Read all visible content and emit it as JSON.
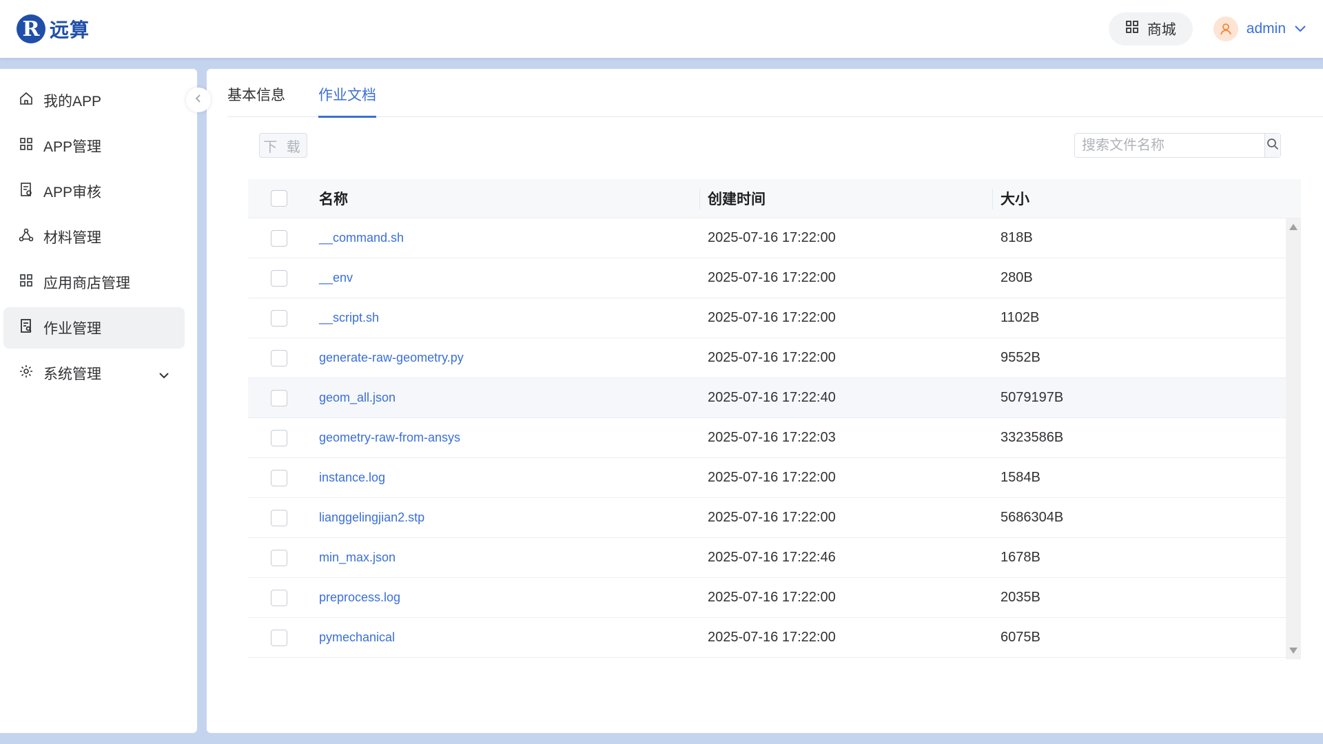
{
  "header": {
    "logo_letter": "R",
    "logo_text": "远算",
    "mall_label": "商城",
    "username": "admin"
  },
  "sidebar": {
    "items": [
      {
        "label": "我的APP",
        "icon": "home-icon"
      },
      {
        "label": "APP管理",
        "icon": "grid-icon"
      },
      {
        "label": "APP审核",
        "icon": "audit-icon"
      },
      {
        "label": "材料管理",
        "icon": "nodes-icon"
      },
      {
        "label": "应用商店管理",
        "icon": "grid-icon"
      },
      {
        "label": "作业管理",
        "icon": "job-icon",
        "active": true
      },
      {
        "label": "系统管理",
        "icon": "gear-icon",
        "expandable": true
      }
    ]
  },
  "tabs": [
    {
      "label": "基本信息",
      "active": false
    },
    {
      "label": "作业文档",
      "active": true
    }
  ],
  "toolbar": {
    "download_label": "下 载",
    "search_placeholder": "搜索文件名称"
  },
  "table": {
    "columns": [
      "名称",
      "创建时间",
      "大小"
    ],
    "rows": [
      {
        "name": "__command.sh",
        "created": "2025-07-16 17:22:00",
        "size": "818B"
      },
      {
        "name": "__env",
        "created": "2025-07-16 17:22:00",
        "size": "280B"
      },
      {
        "name": "__script.sh",
        "created": "2025-07-16 17:22:00",
        "size": "1102B"
      },
      {
        "name": "generate-raw-geometry.py",
        "created": "2025-07-16 17:22:00",
        "size": "9552B"
      },
      {
        "name": "geom_all.json",
        "created": "2025-07-16 17:22:40",
        "size": "5079197B"
      },
      {
        "name": "geometry-raw-from-ansys",
        "created": "2025-07-16 17:22:03",
        "size": "3323586B"
      },
      {
        "name": "instance.log",
        "created": "2025-07-16 17:22:00",
        "size": "1584B"
      },
      {
        "name": "lianggelingjian2.stp",
        "created": "2025-07-16 17:22:00",
        "size": "5686304B"
      },
      {
        "name": "min_max.json",
        "created": "2025-07-16 17:22:46",
        "size": "1678B"
      },
      {
        "name": "preprocess.log",
        "created": "2025-07-16 17:22:00",
        "size": "2035B"
      },
      {
        "name": "pymechanical",
        "created": "2025-07-16 17:22:00",
        "size": "6075B"
      }
    ]
  },
  "colors": {
    "accent": "#3a6fd8",
    "brand": "#1f4fa8",
    "background": "#c5d4ee"
  }
}
